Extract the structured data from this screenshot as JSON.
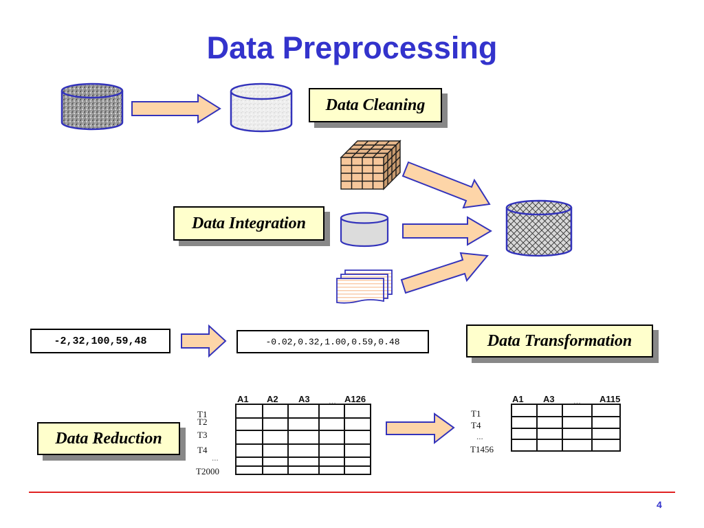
{
  "title": "Data Preprocessing",
  "colors": {
    "title": "#3333cc",
    "arrow_fill": "#fdd5a8",
    "arrow_stroke": "#3333bb",
    "label_bg": "#ffffcc",
    "shadow": "#888888",
    "footer_line": "#e02020",
    "page_number": "#3333cc"
  },
  "sections": {
    "cleaning": {
      "label": "Data Cleaning"
    },
    "integration": {
      "label": "Data Integration"
    },
    "transformation": {
      "label": "Data Transformation",
      "input_values": "-2,32,100,59,48",
      "output_values": "-0.02,0.32,1.00,0.59,0.48"
    },
    "reduction": {
      "label": "Data Reduction",
      "before_table": {
        "columns": [
          "A1",
          "A2",
          "A3",
          "...",
          "A126"
        ],
        "rows": [
          "T1",
          "T2",
          "T3",
          "T4",
          "...",
          "T2000"
        ]
      },
      "after_table": {
        "columns": [
          "A1",
          "A3",
          "...",
          "A115"
        ],
        "rows": [
          "T1",
          "T4",
          "...",
          "T1456"
        ]
      }
    }
  },
  "icons": {
    "dirty_db": "database-noisy-icon",
    "clean_db": "database-clean-icon",
    "cube": "data-cube-icon",
    "grey_db": "database-icon",
    "files": "flat-files-icon",
    "warehouse": "data-warehouse-icon"
  },
  "page_number": "4"
}
